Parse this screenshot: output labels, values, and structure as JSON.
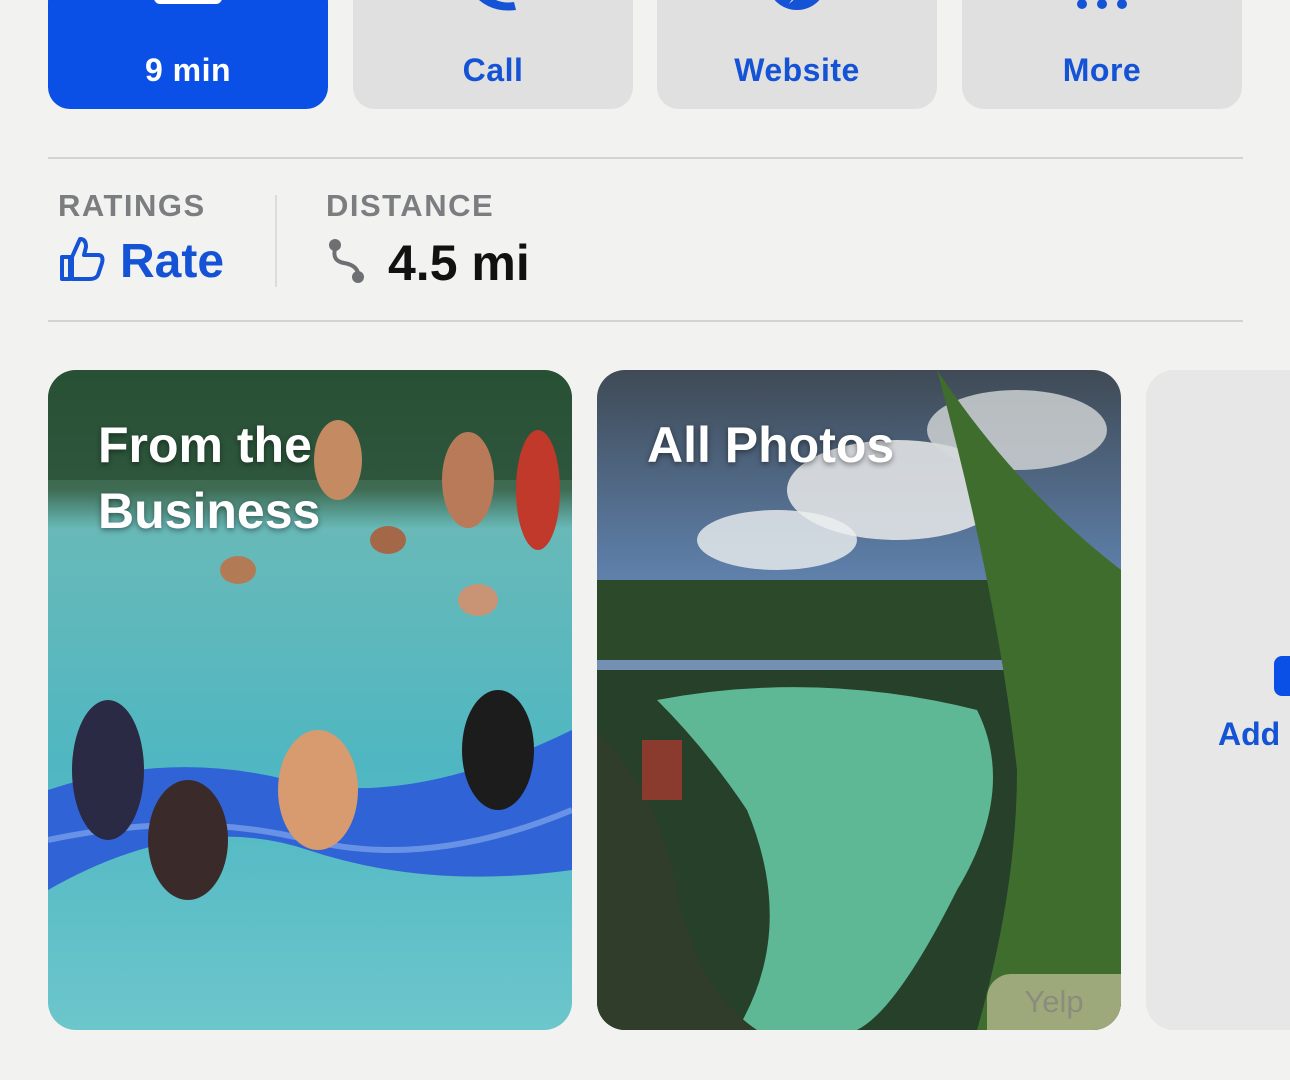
{
  "actions": [
    {
      "label": "9 min",
      "icon": "car-icon"
    },
    {
      "label": "Call",
      "icon": "phone-icon"
    },
    {
      "label": "Website",
      "icon": "compass-icon"
    },
    {
      "label": "More",
      "icon": "ellipsis-icon"
    }
  ],
  "info": {
    "ratings": {
      "title": "RATINGS",
      "value": "Rate",
      "icon": "thumbs-up-icon"
    },
    "distance": {
      "title": "DISTANCE",
      "value": "4.5 mi",
      "icon": "route-icon"
    }
  },
  "photos": {
    "cards": [
      {
        "title": "From the Business"
      },
      {
        "title": "All Photos",
        "badge": "Yelp"
      },
      {
        "title": "Add"
      }
    ]
  },
  "colors": {
    "accent": "#0a50e6",
    "link": "#1452d6",
    "background": "#f2f3f0"
  }
}
